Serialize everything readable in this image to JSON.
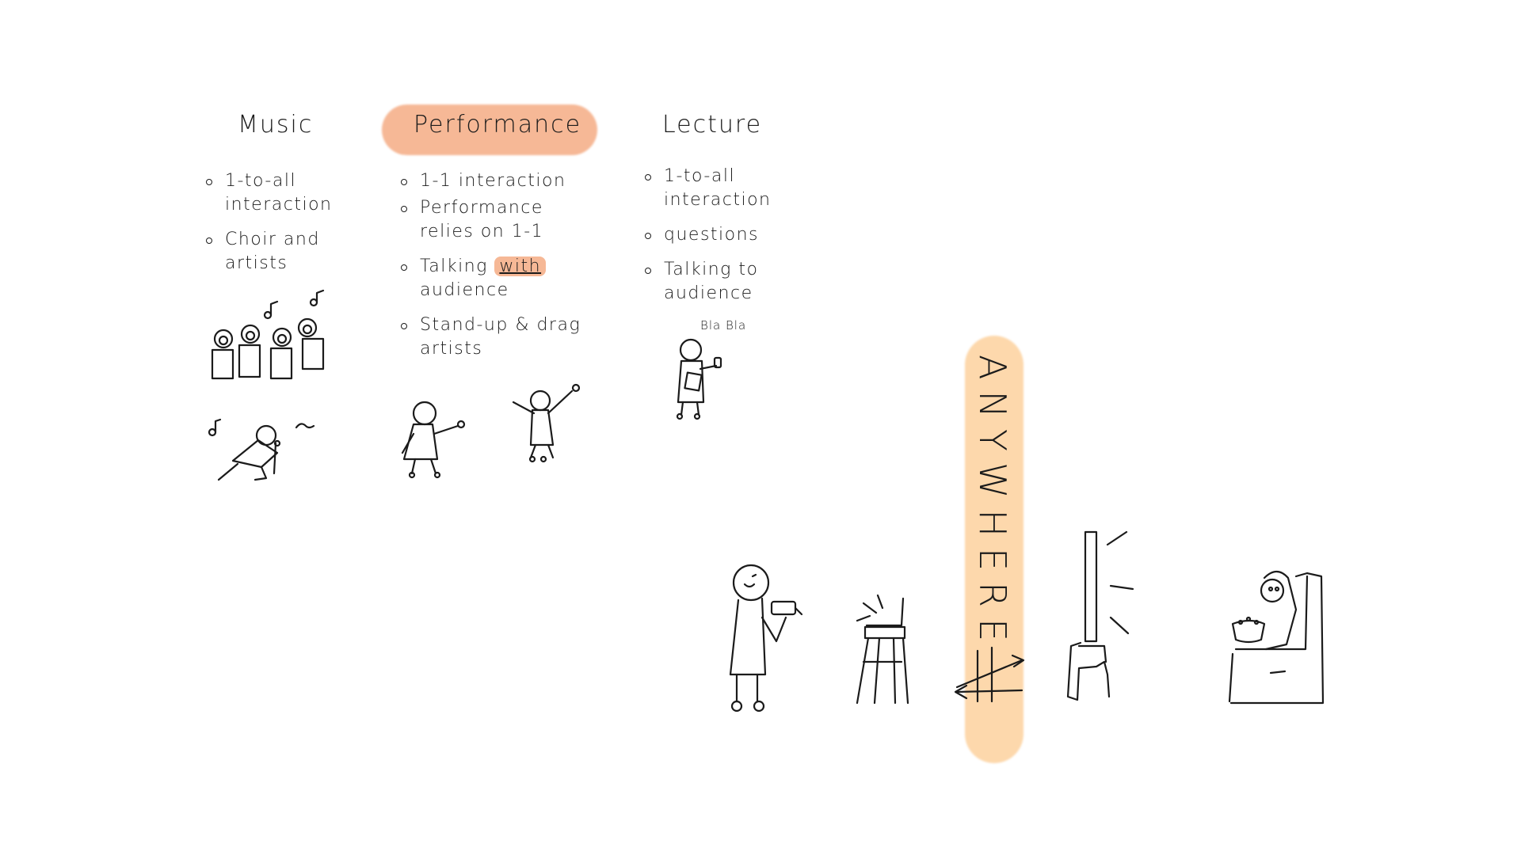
{
  "columns": [
    {
      "title": "Music",
      "bullets": [
        "1-to-all interaction",
        "Choir and artists"
      ]
    },
    {
      "title": "Performance",
      "bullets": [
        "1-1 interaction",
        "Performance relies on 1-1",
        "Talking with audience",
        "Stand-up & drag artists"
      ],
      "talking_prefix": "Talking ",
      "talking_highlight": "with",
      "talking_suffix": " audience"
    },
    {
      "title": "Lecture",
      "bullets": [
        "1-to-all interaction",
        "questions",
        "Talking to audience"
      ]
    }
  ],
  "lecture_speech": "Bla Bla",
  "anywhere_label": "ANYWHERE",
  "colors": {
    "orange_highlight": "#f6b896",
    "yellow_highlight": "#fdd8ac",
    "ink": "#1b1b1b"
  },
  "icons": [
    "music-note-icon",
    "choir-figure",
    "singer-figure",
    "performer-figure",
    "lecturer-figure",
    "phone-user-figure",
    "laptop-stand-icon",
    "tv-icon",
    "armchair-viewer-figure",
    "arrow-icon"
  ]
}
